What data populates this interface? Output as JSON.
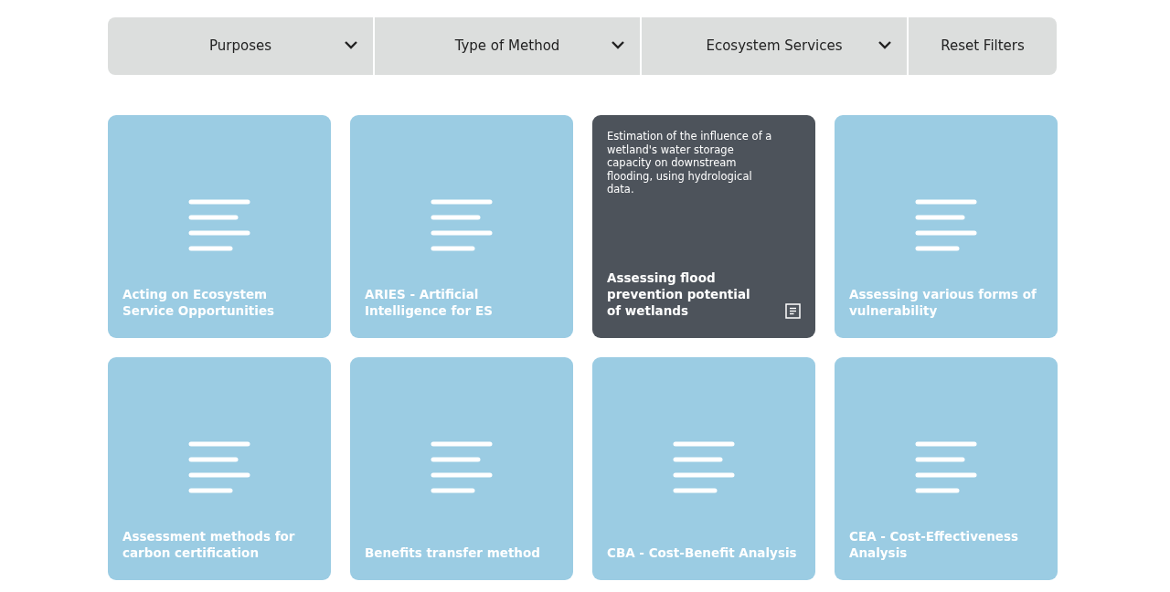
{
  "filters": [
    {
      "kind": "dropdown",
      "label": "Purposes"
    },
    {
      "kind": "dropdown",
      "label": "Type of Method"
    },
    {
      "kind": "dropdown",
      "label": "Ecosystem Services"
    },
    {
      "kind": "reset",
      "label": "Reset Filters"
    }
  ],
  "cards": [
    {
      "title": "Acting on Ecosystem Service Opportunities",
      "highlighted": false
    },
    {
      "title": "ARIES - Artificial Intelligence for ES",
      "highlighted": false
    },
    {
      "title": "Assessing flood prevention potential of wetlands",
      "highlighted": true,
      "description": "Estimation of the influence of a wetland's water storage capacity on downstream flooding, using hydrological data."
    },
    {
      "title": "Assessing various forms of vulnerability",
      "highlighted": false
    },
    {
      "title": "Assessment methods for carbon certification",
      "highlighted": false
    },
    {
      "title": "Benefits transfer method",
      "highlighted": false
    },
    {
      "title": "CBA - Cost-Benefit Analysis",
      "highlighted": false
    },
    {
      "title": "CEA - Cost-Effectiveness Analysis",
      "highlighted": false
    }
  ]
}
